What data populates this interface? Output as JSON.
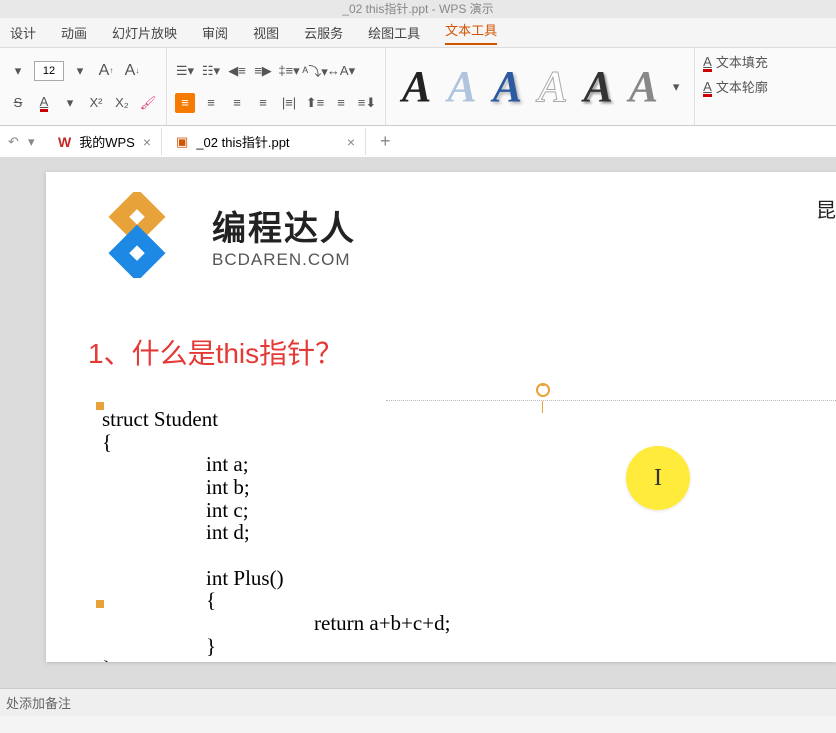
{
  "titlebar": "_02 this指针.ppt - WPS 演示",
  "menu": {
    "items": [
      "设计",
      "动画",
      "幻灯片放映",
      "审阅",
      "视图",
      "云服务",
      "绘图工具",
      "文本工具"
    ],
    "active_index": 7
  },
  "toolbar": {
    "font_size": "12",
    "text_fill": "文本填充",
    "text_outline": "文本轮廓"
  },
  "tabs": {
    "items": [
      {
        "icon": "wps",
        "label": "我的WPS"
      },
      {
        "icon": "ppt",
        "label": "_02 this指针.ppt"
      }
    ]
  },
  "slide": {
    "logo_main": "编程达人",
    "logo_sub": "BCDAREN.COM",
    "top_right": "昆",
    "heading": "1、什么是this指针？",
    "code": {
      "l1": "struct Student",
      "l2": "{",
      "l3": "int a;",
      "l4": "int b;",
      "l5": "int c;",
      "l6": "int d;",
      "l7": "",
      "l8": "int Plus()",
      "l9": "{",
      "l10": "return a+b+c+d;",
      "l11": "}",
      "l12": "};"
    },
    "cursor_char": "I"
  },
  "notes": "处添加备注"
}
